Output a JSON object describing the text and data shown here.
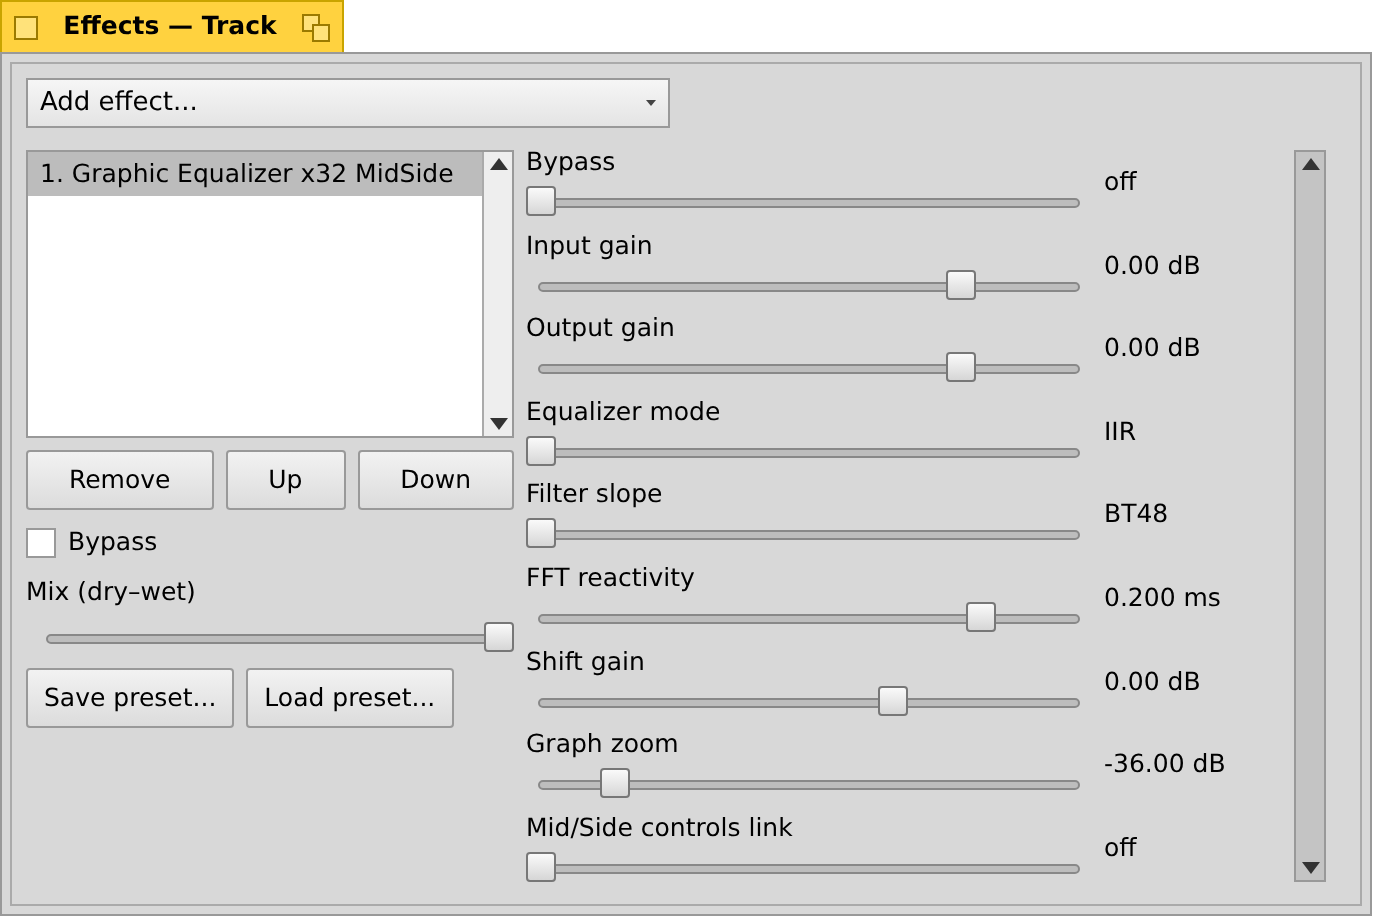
{
  "window": {
    "title": "Effects — Track"
  },
  "add_effect": {
    "value": "Add effect..."
  },
  "effects_list": {
    "items": [
      {
        "label": "1. Graphic Equalizer x32 MidSide",
        "selected": true
      }
    ]
  },
  "list_buttons": [
    "Remove",
    "Up",
    "Down"
  ],
  "bypass": {
    "label": "Bypass",
    "checked": false
  },
  "mix": {
    "label": "Mix (dry–wet)",
    "level": 1.0
  },
  "preset_buttons": [
    "Save preset...",
    "Load preset..."
  ],
  "parameters": [
    {
      "label": "Bypass",
      "level": 0,
      "reading": "off"
    },
    {
      "label": "Input gain",
      "level": 0.8,
      "reading": "0.00 dB"
    },
    {
      "label": "Output gain",
      "level": 0.8,
      "reading": "0.00 dB"
    },
    {
      "label": "Equalizer mode",
      "level": 0,
      "reading": "IIR"
    },
    {
      "label": "Filter slope",
      "level": 0,
      "reading": "BT48"
    },
    {
      "label": "FFT reactivity",
      "level": 0.84,
      "reading": "0.200 ms"
    },
    {
      "label": "Shift gain",
      "level": 0.67,
      "reading": "0.00 dB"
    },
    {
      "label": "Graph zoom",
      "level": 0.14,
      "reading": "-36.00 dB"
    },
    {
      "label": "Mid/Side controls link",
      "level": 0,
      "reading": "off"
    }
  ]
}
